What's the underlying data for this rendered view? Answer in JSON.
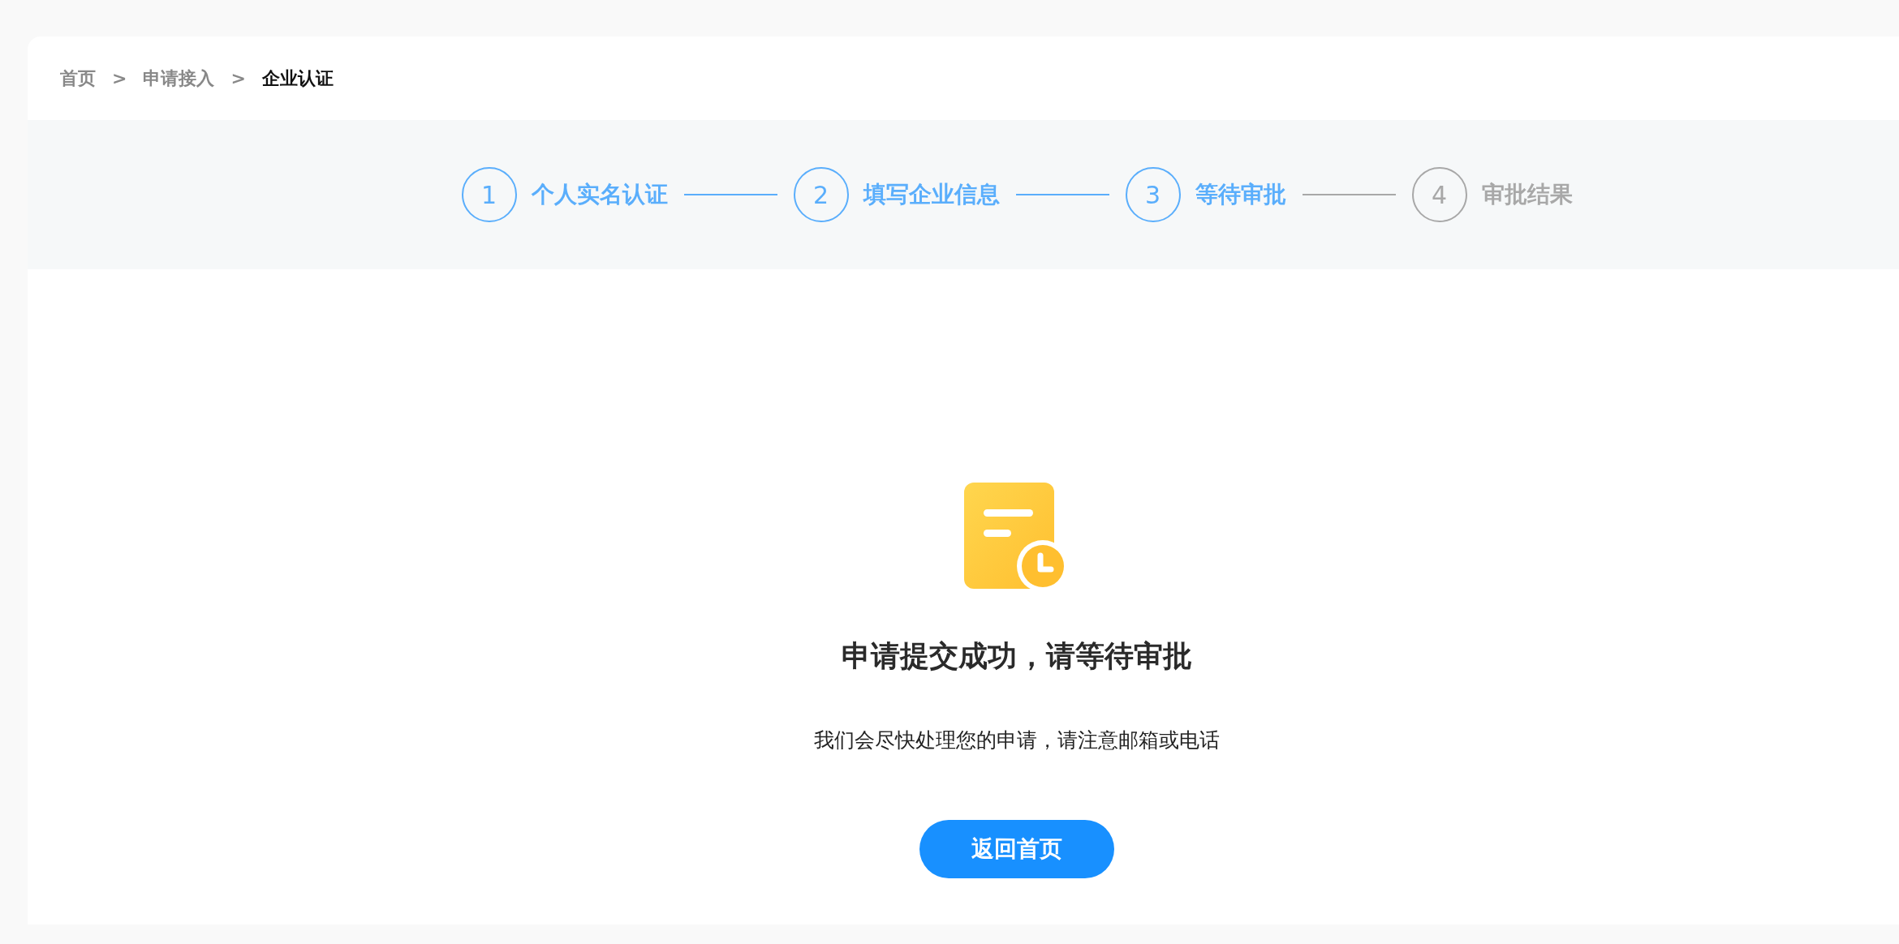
{
  "breadcrumb": [
    {
      "label": "首页",
      "current": false
    },
    {
      "label": ">",
      "kind": "separator"
    },
    {
      "label": "申请接入",
      "current": false
    },
    {
      "label": ">",
      "kind": "separator"
    },
    {
      "label": "企业认证",
      "current": true
    }
  ],
  "steps": [
    {
      "number": "1",
      "label": "个人实名认证",
      "done": true
    },
    {
      "number": "2",
      "label": "填写企业信息",
      "done": true
    },
    {
      "number": "3",
      "label": "等待审批",
      "done": true
    },
    {
      "number": "4",
      "label": "审批结果",
      "done": false
    }
  ],
  "result": {
    "title": "申请提交成功，请等待审批",
    "message": "我们会尽快处理您的申请，请注意邮箱或电话",
    "button": "返回首页"
  }
}
